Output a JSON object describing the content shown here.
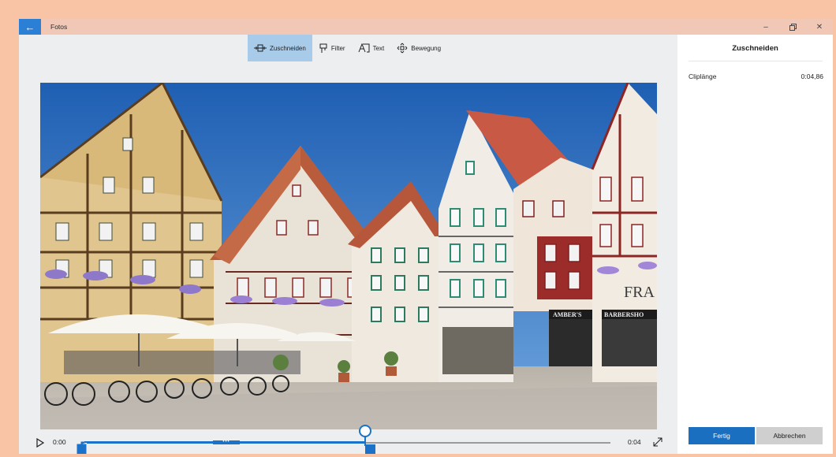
{
  "window": {
    "app_title": "Fotos",
    "back_icon": "arrow-left-icon",
    "controls": [
      "minimize-icon",
      "restore-icon",
      "close-icon"
    ]
  },
  "toolbar": {
    "tools": [
      {
        "label": "Zuschneiden",
        "icon": "trim-icon",
        "active": true
      },
      {
        "label": "Filter",
        "icon": "filter-icon",
        "active": false
      },
      {
        "label": "Text",
        "icon": "text-icon",
        "active": false
      },
      {
        "label": "Bewegung",
        "icon": "motion-icon",
        "active": false
      }
    ]
  },
  "video": {
    "storefront_1": "AMBER'S",
    "storefront_2": "BARBERSHO",
    "facade_lettering": "FRA"
  },
  "timeline": {
    "time_start": "0:00",
    "time_end": "0:04",
    "play_icon": "play-icon",
    "expand_icon": "expand-icon",
    "selection_fraction": 0.53,
    "playhead_fraction": 0.53
  },
  "panel": {
    "title": "Zuschneiden",
    "clip_label": "Cliplänge",
    "clip_value": "0:04,86",
    "ok_label": "Fertig",
    "cancel_label": "Abbrechen"
  },
  "colors": {
    "accent": "#1a73c8",
    "titlebar": "#f1c8b6",
    "frame": "#f9c4a6"
  }
}
